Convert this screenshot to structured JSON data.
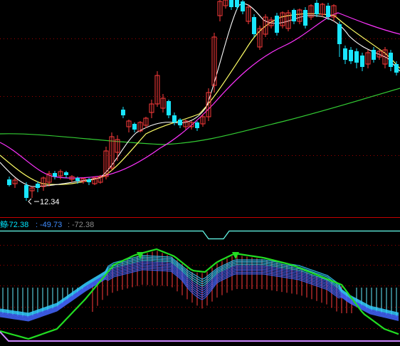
{
  "price_panel": {
    "low_marker_label": "12.34"
  },
  "indicator_header": {
    "prefix": "鲸",
    "values": [
      "-72.38",
      "-49.73",
      "-72.38"
    ],
    "colors": [
      "#00e6ff",
      "#3f8cff",
      "#8a8a8a"
    ]
  },
  "colors": {
    "background": "#000000",
    "up_candle": "#ff3b3b",
    "down_candle": "#19e6ff",
    "ma_white": "#ffffff",
    "ma_yellow": "#ffff66",
    "ma_magenta": "#ff33ff",
    "ma_green": "#33cc33",
    "panel_divider": "#c40000",
    "grid_dots": "#a00000",
    "envelope_green": "#22dd22",
    "bar_red": "#ff3b3b",
    "bar_cyan": "#66eeff",
    "band_blue": "#4466ff",
    "band_cyan": "#33ccff",
    "bottom_line": "#cc88ff",
    "top_bracket": "#66ffee"
  },
  "chart_data": {
    "type": "candlestick",
    "title": "",
    "annotations": [
      "12.34"
    ],
    "low_value": 12.34,
    "indicator_values": [
      -72.38,
      -49.73,
      -72.38
    ]
  }
}
